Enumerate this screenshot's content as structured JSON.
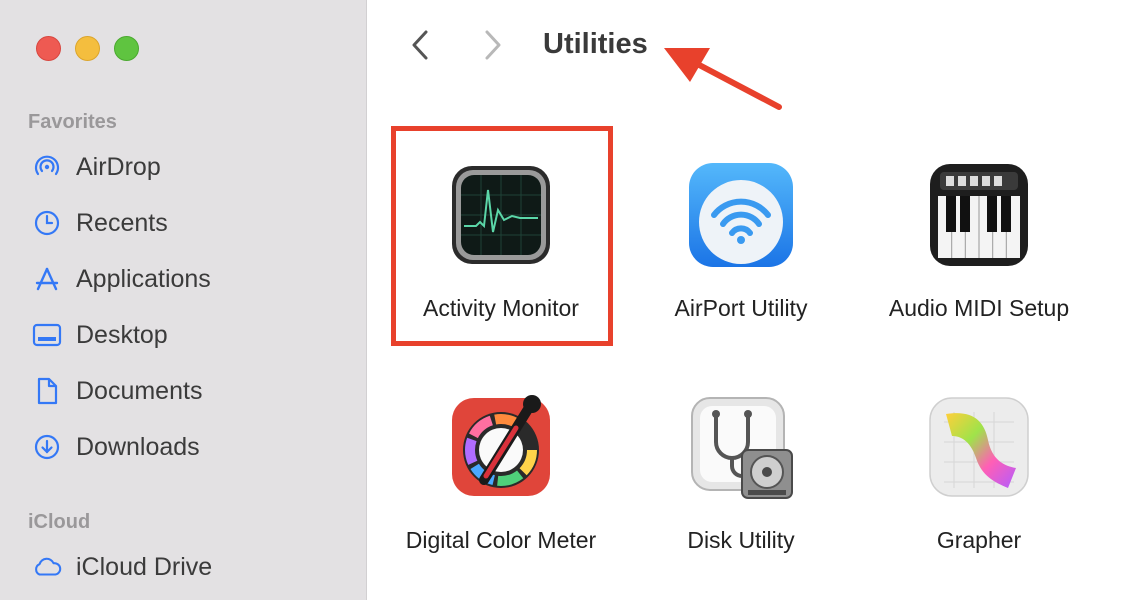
{
  "window": {
    "title": "Utilities"
  },
  "sidebar": {
    "favorites_heading": "Favorites",
    "items": [
      {
        "label": "AirDrop",
        "icon": "airdrop-icon"
      },
      {
        "label": "Recents",
        "icon": "clock-icon"
      },
      {
        "label": "Applications",
        "icon": "applications-icon"
      },
      {
        "label": "Desktop",
        "icon": "desktop-icon"
      },
      {
        "label": "Documents",
        "icon": "document-icon"
      },
      {
        "label": "Downloads",
        "icon": "download-icon"
      }
    ],
    "icloud_heading": "iCloud",
    "icloud_items": [
      {
        "label": "iCloud Drive",
        "icon": "cloud-icon"
      }
    ]
  },
  "nav": {
    "back_icon": "chevron-left-icon",
    "forward_icon": "chevron-right-icon"
  },
  "apps": [
    {
      "label": "Activity Monitor",
      "icon": "activity-monitor-icon"
    },
    {
      "label": "AirPort Utility",
      "icon": "airport-utility-icon"
    },
    {
      "label": "Audio MIDI Setup",
      "icon": "audio-midi-icon"
    },
    {
      "label": "Digital Color Meter",
      "icon": "digital-color-meter-icon"
    },
    {
      "label": "Disk Utility",
      "icon": "disk-utility-icon"
    },
    {
      "label": "Grapher",
      "icon": "grapher-icon"
    }
  ],
  "annotation": {
    "highlight_color": "#e8412c",
    "arrow_color": "#e8412c"
  },
  "colors": {
    "sidebar_icon": "#3478f6",
    "sidebar_bg": "#e3e1e3"
  }
}
